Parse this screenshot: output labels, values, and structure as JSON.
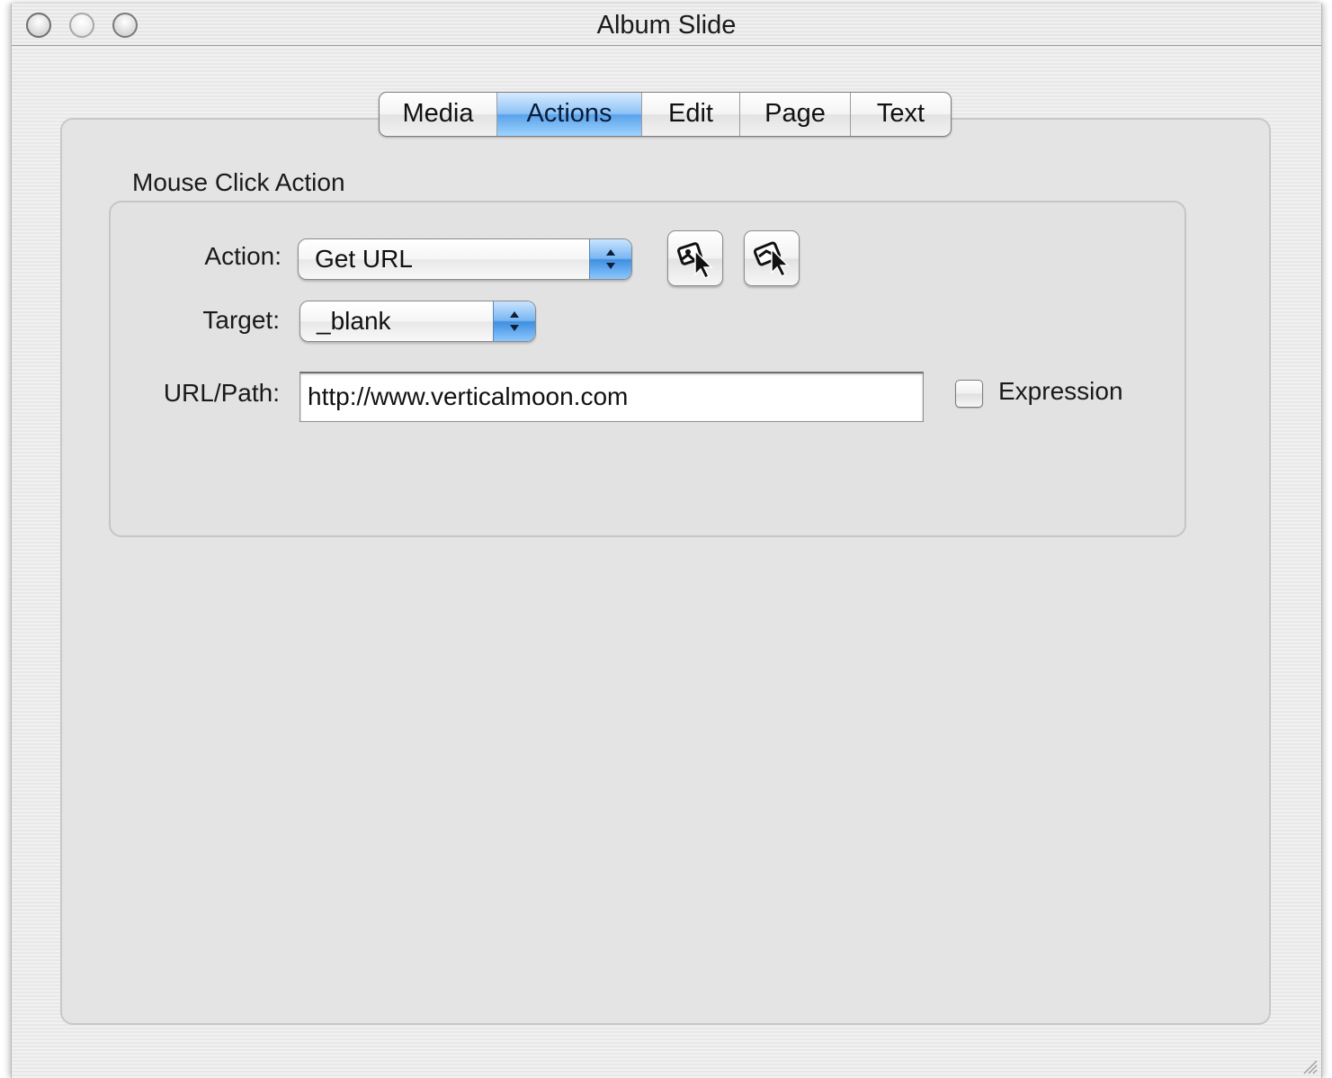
{
  "window": {
    "title": "Album Slide"
  },
  "tabs": [
    {
      "label": "Media",
      "active": false
    },
    {
      "label": "Actions",
      "active": true
    },
    {
      "label": "Edit",
      "active": false
    },
    {
      "label": "Page",
      "active": false
    },
    {
      "label": "Text",
      "active": false
    }
  ],
  "group": {
    "title": "Mouse Click Action"
  },
  "form": {
    "action_label": "Action:",
    "action_value": "Get URL",
    "target_label": "Target:",
    "target_value": "_blank",
    "url_label": "URL/Path:",
    "url_value": "http://www.verticalmoon.com",
    "expression_label": "Expression",
    "expression_checked": false
  },
  "icons": {
    "button1": "pick-object-cursor-icon",
    "button2": "pick-page-cursor-icon"
  },
  "colors": {
    "accent": "#5aa3ea",
    "panel": "#e4e4e4"
  }
}
